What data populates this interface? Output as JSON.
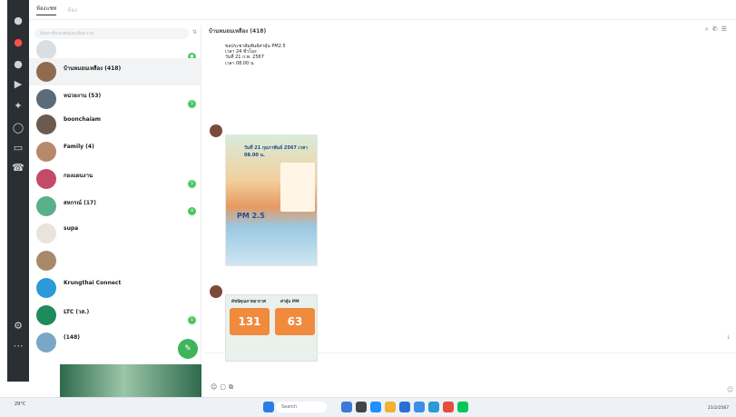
{
  "tabs": [
    "ห้องแชท",
    "ห้อง",
    "",
    "",
    ""
  ],
  "search": {
    "placeholder": "ค้นหาห้องแชทและข้อความ"
  },
  "chats": [
    {
      "name": "",
      "preview": "",
      "time": "",
      "badge": "",
      "color": "#d9dee3"
    },
    {
      "name": "บ้านหมอนเหลือง (418)",
      "preview": "",
      "time": "",
      "badge": "",
      "color": "#8e6b4f"
    },
    {
      "name": "หน่วยงาน (53)",
      "preview": "",
      "time": "",
      "badge": "5",
      "color": "#5a6b7a"
    },
    {
      "name": "boonchaiam",
      "preview": "",
      "time": "",
      "badge": "",
      "color": "#6b5a50"
    },
    {
      "name": "Family (4)",
      "preview": "",
      "time": "",
      "badge": "",
      "color": "#b7896b"
    },
    {
      "name": "กองแผนงาน",
      "preview": "",
      "time": "",
      "badge": "5",
      "color": "#c54a6a"
    },
    {
      "name": "สหกรณ์ (17)",
      "preview": "",
      "time": "",
      "badge": "4",
      "color": "#5ab08a"
    },
    {
      "name": "supa",
      "preview": "",
      "time": "",
      "badge": "",
      "color": "#e8e3dc"
    },
    {
      "name": "",
      "preview": "",
      "time": "",
      "badge": "",
      "color": "#a88a6a"
    },
    {
      "name": "Krungthai Connect",
      "preview": "",
      "time": "",
      "badge": "",
      "color": "#2a9ad8"
    },
    {
      "name": "LTC (วส.)",
      "preview": "",
      "time": "",
      "badge": "1",
      "color": "#1f8a5a"
    },
    {
      "name": "(148)",
      "preview": "",
      "time": "",
      "badge": "",
      "color": "#7aa6c7"
    }
  ],
  "banner": {
    "title": "",
    "desc": ""
  },
  "chat": {
    "title": "บ้านหมอนเหลือง (418)"
  },
  "message": {
    "lines": [
      "ขอประชาสัมพันธ์ค่าฝุ่น PM2.5",
      "เวลา 24 ชั่วโมง",
      "วันที่ 21 ก.พ. 2567",
      "เวลา 08.00 น.",
      "",
      "",
      ""
    ],
    "footer": ""
  },
  "poster": {
    "header": "",
    "date": "วันที่ 21 กุมภาพันธ์ 2567 เวลา 08.00 น.",
    "pm": "PM 2.5",
    "sender": "",
    "stamp": ""
  },
  "aq": {
    "left_title": "ดัชนีคุณภาพอากาศ",
    "right_title": "ค่าฝุ่น PM",
    "left_value": "131",
    "right_value": "63",
    "footer": "",
    "sender": "",
    "stamp": ""
  },
  "input": {
    "placeholder": ""
  },
  "taskbar": {
    "weather_temp": "29°C",
    "weather_note": "",
    "search": "Search",
    "tray": "",
    "time": "",
    "date": "21/2/2567"
  }
}
